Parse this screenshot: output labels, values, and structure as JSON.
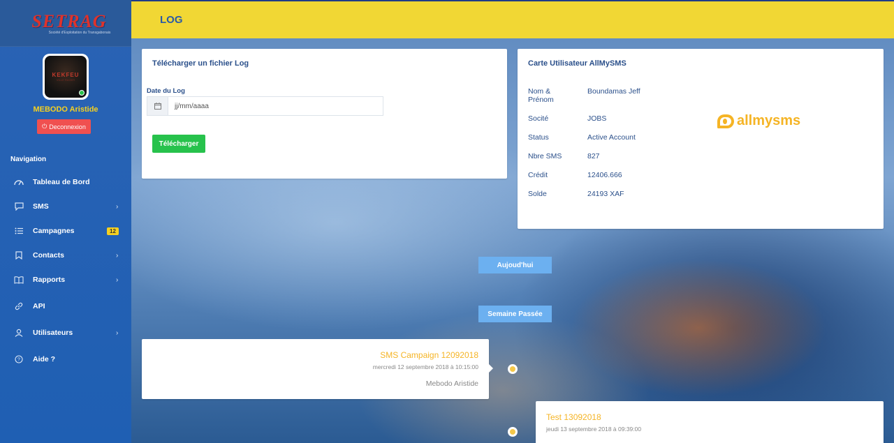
{
  "brand": {
    "logo_text": "SETRAG",
    "logo_subtitle": "Société d'Exploitation du Transgabonais"
  },
  "user": {
    "name": "MEBODO Aristide",
    "avatar_text": "KEKFEU",
    "avatar_subtext": "VILLE RAGER"
  },
  "logout_label": "Deconnexion",
  "nav": {
    "title": "Navigation",
    "items": [
      {
        "label": "Tableau de Bord",
        "icon": "dashboard-icon"
      },
      {
        "label": "SMS",
        "icon": "chat-icon",
        "arrow": true
      },
      {
        "label": "Campagnes",
        "icon": "list-icon",
        "badge": "12"
      },
      {
        "label": "Contacts",
        "icon": "bookmark-icon",
        "arrow": true
      },
      {
        "label": "Rapports",
        "icon": "book-icon",
        "arrow": true
      },
      {
        "label": "API",
        "icon": "link-icon"
      },
      {
        "label": "Utilisateurs",
        "icon": "user-icon",
        "arrow": true
      },
      {
        "label": "Aide ?",
        "icon": "help-icon"
      }
    ]
  },
  "header": {
    "title": "LOG"
  },
  "log_card": {
    "title": "Télécharger un fichier Log",
    "date_label": "Date du Log",
    "date_value": "jj/mm/aaaa",
    "button_label": "Télécharger"
  },
  "user_card": {
    "title": "Carte Utilisateur AllMySMS",
    "fields": [
      {
        "label": "Nom & Prénom",
        "value": "Boundamas Jeff"
      },
      {
        "label": "Socité",
        "value": "JOBS"
      },
      {
        "label": "Status",
        "value": "Active Account"
      },
      {
        "label": "Nbre SMS",
        "value": "827"
      },
      {
        "label": "Crédit",
        "value": "12406.666"
      },
      {
        "label": "Solde",
        "value": "24193 XAF"
      }
    ],
    "brand_text": "allmysms"
  },
  "timeline": {
    "today_label": "Aujoud'hui",
    "last_week_label": "Semaine Passée",
    "entries": [
      {
        "title": "SMS Campaign 12092018",
        "date": "mercredi 12 septembre 2018 à 10:15:00",
        "author": "Mebodo Aristide"
      },
      {
        "title": "Test 13092018",
        "date": "jeudi 13 septembre 2018 à 09:39:00"
      }
    ]
  },
  "colors": {
    "accent": "#f1d734",
    "sidebar": "#1f5fb3",
    "success": "#27c24c",
    "danger": "#f05050",
    "timeline_tag": "#6cb0f0"
  }
}
